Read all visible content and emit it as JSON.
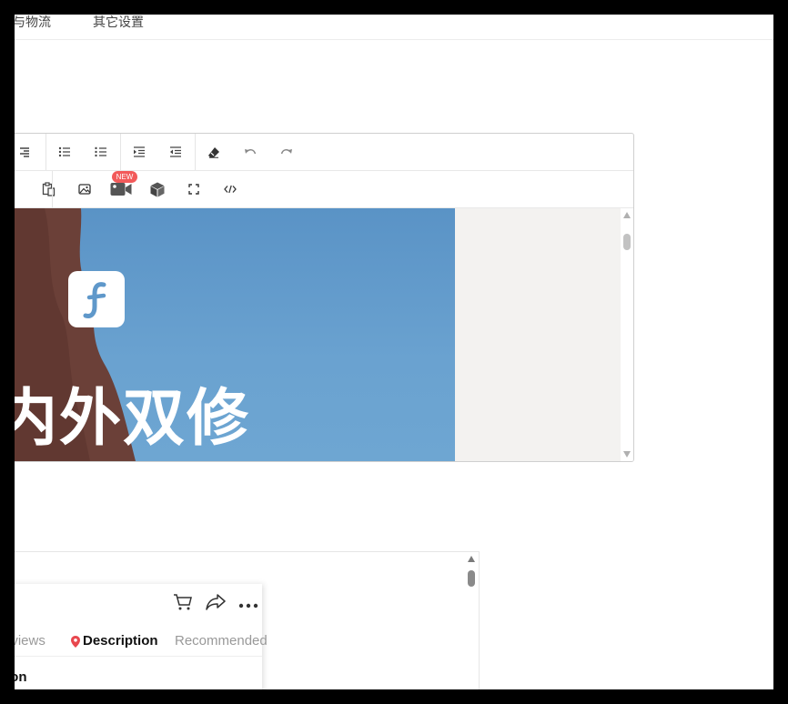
{
  "top_tabs": [
    {
      "label": "务与物流"
    },
    {
      "label": "其它设置"
    }
  ],
  "editor": {
    "new_badge": "NEW",
    "banner_text": "内外双修"
  },
  "preview": {
    "tabs": [
      {
        "label": "eviews"
      },
      {
        "label": "Description"
      },
      {
        "label": "Recommended"
      }
    ],
    "section_title": "tion"
  },
  "colors": {
    "banner_sky": "#5f98ca",
    "badge": "#f25a5a",
    "location_pin": "#e8474e"
  },
  "icons": {
    "toolbar_row_1": [
      "align-right-icon",
      "bulleted-list-icon",
      "numbered-list-icon",
      "indent-icon",
      "outdent-icon",
      "eraser-icon",
      "undo-icon",
      "redo-icon"
    ],
    "toolbar_row_2": [
      "paste-icon",
      "image-icon",
      "video-icon",
      "3d-box-icon",
      "fullscreen-icon",
      "code-icon"
    ],
    "preview_actions": [
      "cart-icon",
      "share-icon",
      "more-icon"
    ]
  }
}
